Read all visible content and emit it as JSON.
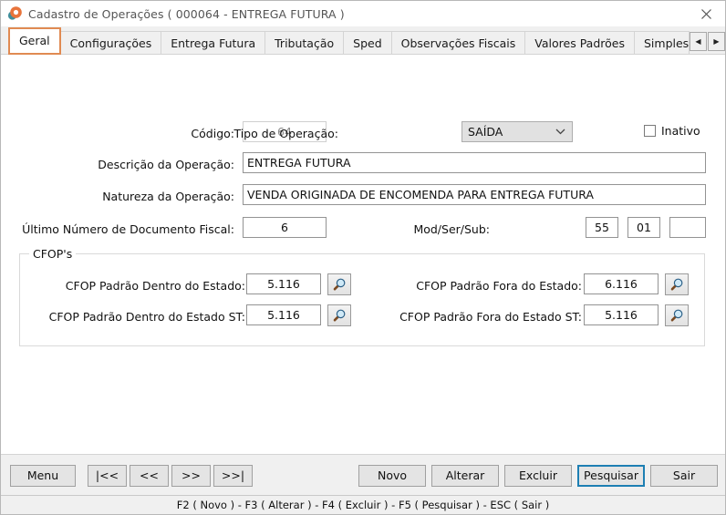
{
  "window": {
    "title": "Cadastro de Operações ( 000064 - ENTREGA FUTURA )",
    "app_icon": "app-icon",
    "close_label": "×"
  },
  "tabs": {
    "items": [
      {
        "label": "Geral",
        "active": true
      },
      {
        "label": "Configurações",
        "active": false
      },
      {
        "label": "Entrega Futura",
        "active": false
      },
      {
        "label": "Tributação",
        "active": false
      },
      {
        "label": "Sped",
        "active": false
      },
      {
        "label": "Observações Fiscais",
        "active": false
      },
      {
        "label": "Valores Padrões",
        "active": false
      },
      {
        "label": "Simples N",
        "active": false
      }
    ],
    "scroll_left": "◀",
    "scroll_right": "▶"
  },
  "form": {
    "codigo_label": "Código:",
    "codigo_value": "64",
    "tipo_operacao_label": "Tipo de Operação:",
    "tipo_operacao_value": "SAÍDA",
    "inativo_label": "Inativo",
    "inativo_checked": false,
    "descricao_label": "Descrição da Operação:",
    "descricao_value": "ENTREGA FUTURA",
    "natureza_label": "Natureza da Operação:",
    "natureza_value": "VENDA ORIGINADA DE ENCOMENDA PARA ENTREGA FUTURA",
    "ultimo_numero_label": "Último Número de Documento Fiscal:",
    "ultimo_numero_value": "6",
    "modsersub_label": "Mod/Ser/Sub:",
    "mod_value": "55",
    "ser_value": "01",
    "sub_value": ""
  },
  "cfop": {
    "group_title": "CFOP's",
    "dentro_label": "CFOP Padrão Dentro do Estado:",
    "dentro_value": "5.116",
    "fora_label": "CFOP Padrão Fora do Estado:",
    "fora_value": "6.116",
    "dentro_st_label": "CFOP Padrão Dentro do Estado ST:",
    "dentro_st_value": "5.116",
    "fora_st_label": "CFOP Padrão Fora do Estado ST:",
    "fora_st_value": "5.116",
    "lookup_icon": "search-icon"
  },
  "toolbar": {
    "menu": "Menu",
    "first": "|<<",
    "prev": "<<",
    "next": ">>",
    "last": ">>|",
    "novo": "Novo",
    "alterar": "Alterar",
    "excluir": "Excluir",
    "pesquisar": "Pesquisar",
    "sair": "Sair"
  },
  "statusbar": {
    "text": "F2 ( Novo )  -  F3 ( Alterar )  -  F4 ( Excluir )  -  F5 ( Pesquisar )  -  ESC ( Sair )"
  },
  "colors": {
    "accent_tab": "#e08a52",
    "focus_button": "#1d7fb3",
    "window_bg": "#f0f0f0"
  }
}
